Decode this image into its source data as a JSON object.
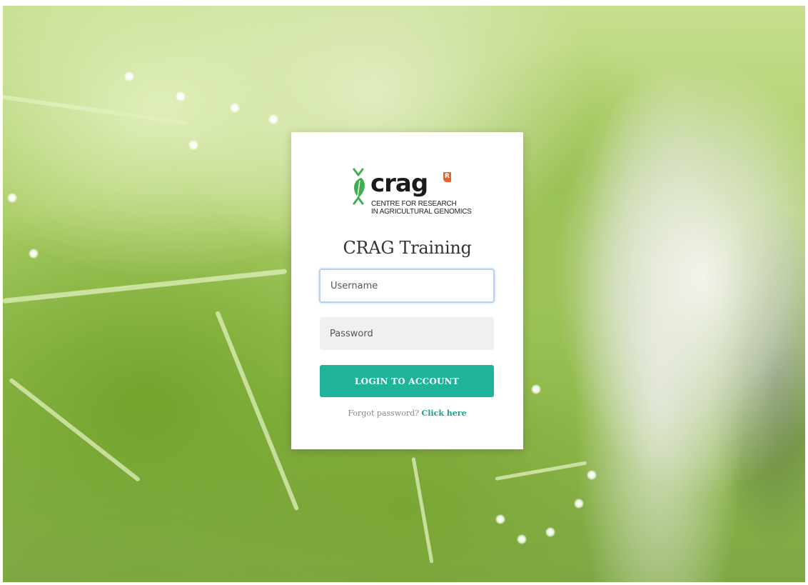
{
  "brand": {
    "wordmark": "crag",
    "badge": "R",
    "subtitle_line1": "CENTRE FOR RESEARCH",
    "subtitle_line2": "IN AGRICULTURAL GENOMICS",
    "colors": {
      "leaf": "#3fae4c",
      "badge": "#e8612c",
      "wordmark": "#1b1b1b"
    }
  },
  "login": {
    "title": "CRAG Training",
    "username_placeholder": "Username",
    "password_placeholder": "Password",
    "submit_label": "LOGIN TO ACCOUNT",
    "forgot_text": "Forgot password?",
    "forgot_link": "Click here"
  },
  "colors": {
    "accent": "#1fb39a",
    "link": "#1fa08a",
    "focus_border": "#b5d0f0"
  }
}
